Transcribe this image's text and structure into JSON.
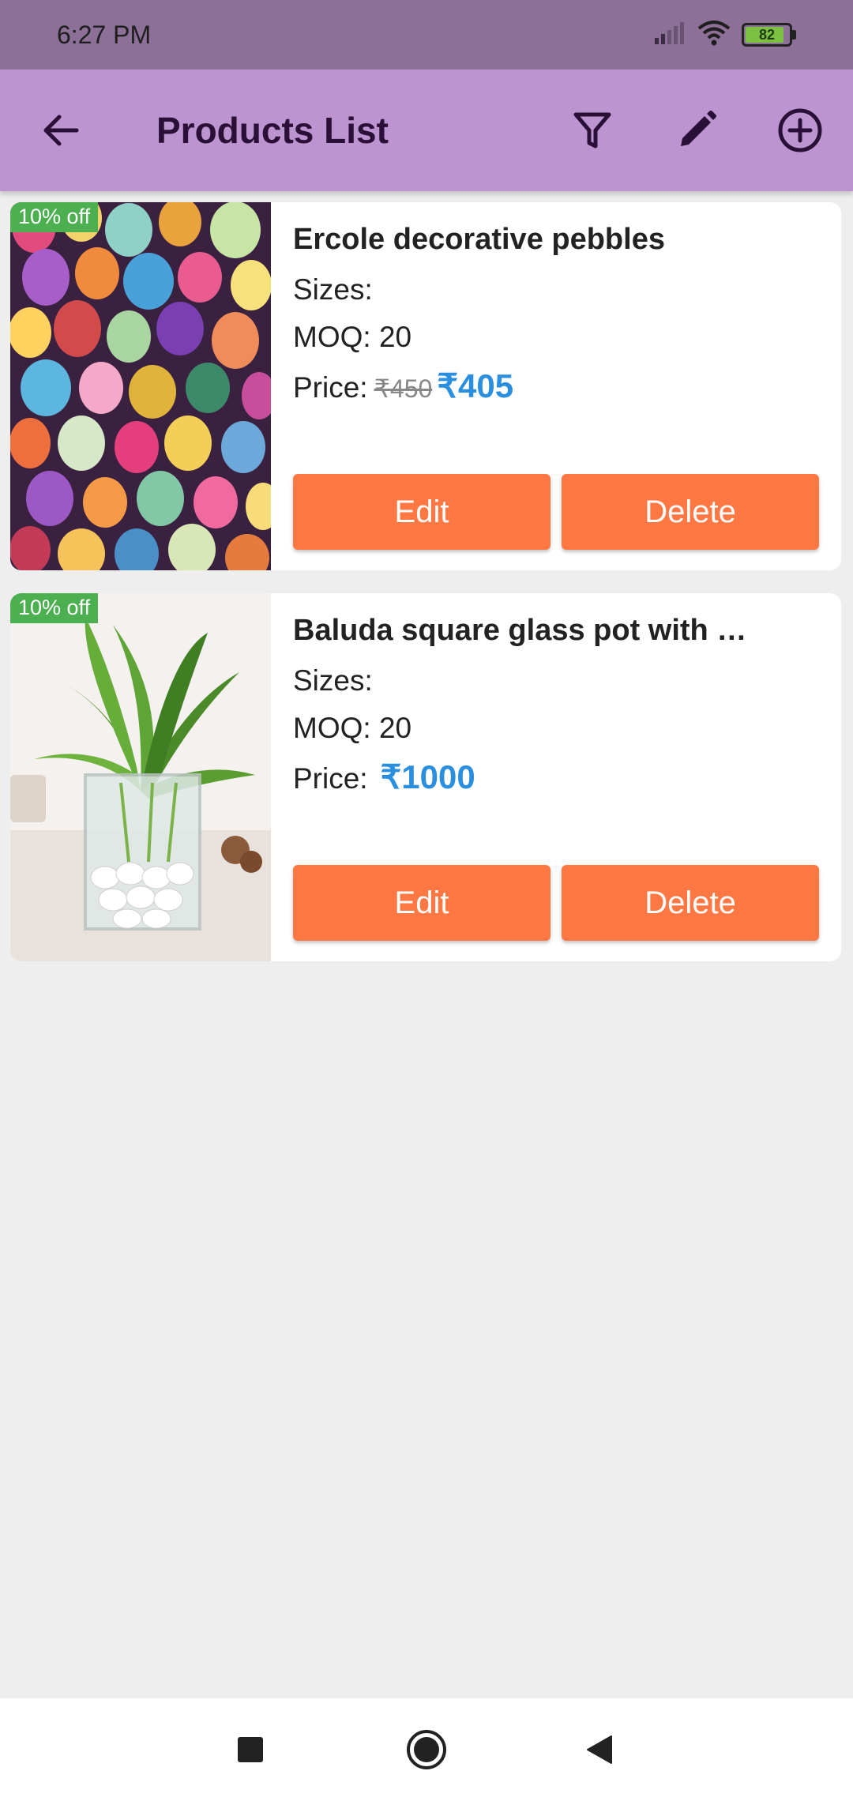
{
  "status_bar": {
    "time": "6:27 PM",
    "battery_level": "82",
    "icons": [
      "signal-icon",
      "wifi-icon",
      "battery-icon"
    ]
  },
  "app_bar": {
    "title": "Products List",
    "icons": [
      "back-arrow-icon",
      "filter-icon",
      "edit-pencil-icon",
      "add-circle-icon"
    ]
  },
  "products": [
    {
      "badge": "10% off",
      "title": "Ercole decorative pebbles",
      "sizes": "Sizes:",
      "moq": "MOQ: 20",
      "price_label": "Price:",
      "original_price": "₹450",
      "price": "₹405",
      "edit_label": "Edit",
      "delete_label": "Delete"
    },
    {
      "badge": "10% off",
      "title": "Baluda square glass pot with …",
      "sizes": "Sizes:",
      "moq": "MOQ: 20",
      "price_label": "Price:",
      "original_price": "",
      "price": "₹1000",
      "edit_label": "Edit",
      "delete_label": "Delete"
    }
  ],
  "colors": {
    "status_bar": "#8c7098",
    "app_bar": "#bb94d0",
    "button": "#ff7843",
    "price": "#2b8fe0",
    "badge": "#4caf50",
    "background": "#eeeeee"
  },
  "nav_bar": {
    "icons": [
      "recents-square-icon",
      "home-circle-icon",
      "back-triangle-icon"
    ]
  }
}
